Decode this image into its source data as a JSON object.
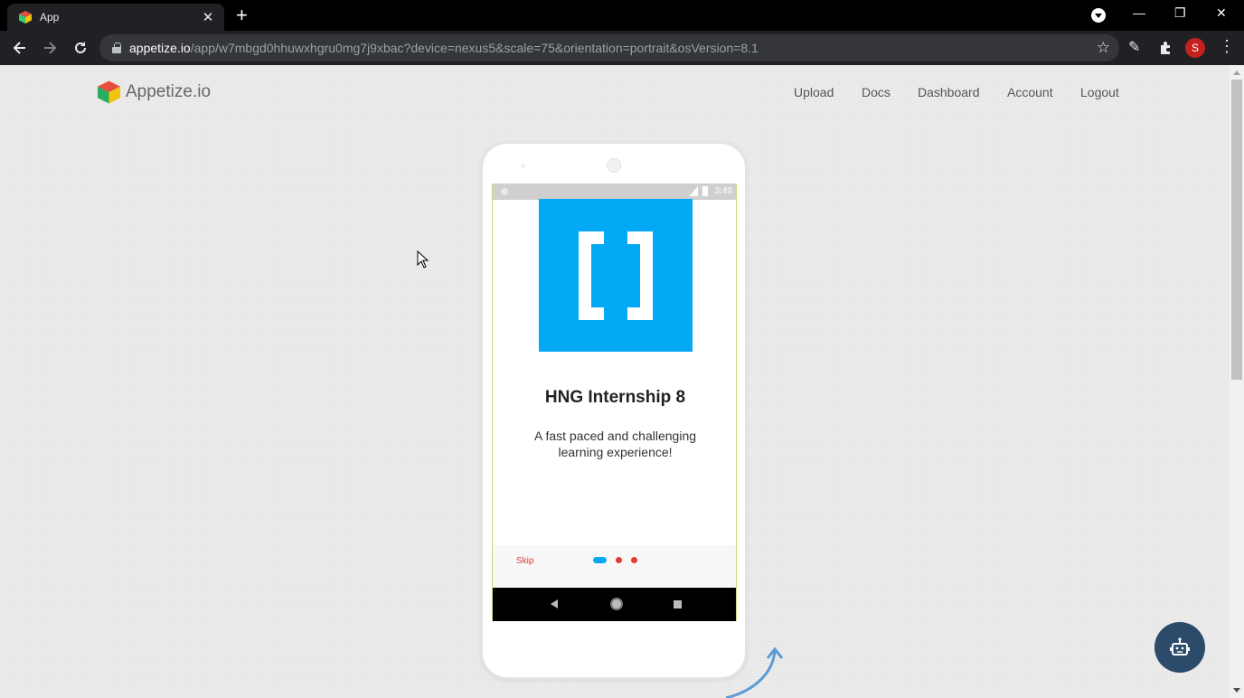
{
  "browser": {
    "tab_title": "App",
    "tab_close": "✕",
    "new_tab": "+",
    "url_host": "appetize.io",
    "url_path": "/app/w7mbgd0hhuwxhgru0mg7j9xbac?device=nexus5&scale=75&orientation=portrait&osVersion=8.1",
    "profile_initial": "S",
    "window_controls": {
      "minimize": "—",
      "maximize": "❐",
      "close": "✕"
    },
    "icons": [
      "back-arrow-icon",
      "forward-arrow-icon",
      "reload-icon",
      "lock-icon",
      "star-icon",
      "pen-icon",
      "extensions-icon",
      "kebab-menu-icon"
    ]
  },
  "site": {
    "brand": "Appetize.io",
    "nav": [
      "Upload",
      "Docs",
      "Dashboard",
      "Account",
      "Logout"
    ]
  },
  "device": {
    "status_time": "3:49",
    "app_title": "HNG Internship 8",
    "app_subtitle": "A fast paced and challenging learning experience!",
    "skip_label": "Skip",
    "onboarding_total_pages": 3,
    "onboarding_current_page": 1
  },
  "colors": {
    "accent_blue": "#03a9f4",
    "skip_red": "#e53935",
    "chat_bubble": "#2c4a6a",
    "chrome_dark": "#202124"
  }
}
